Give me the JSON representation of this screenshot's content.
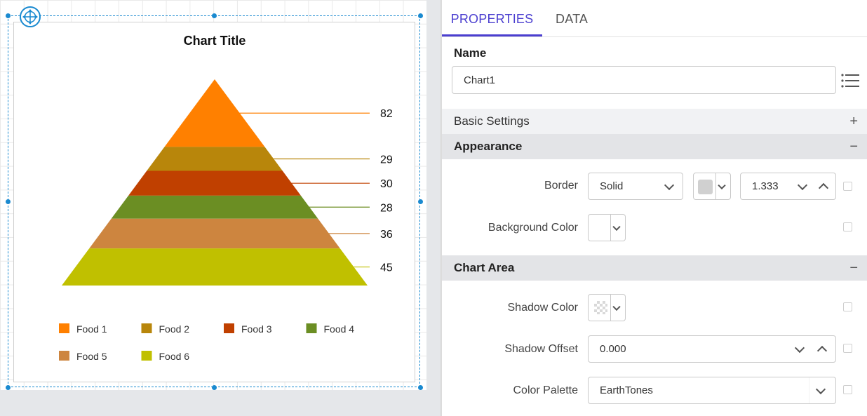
{
  "chart_data": {
    "type": "pyramid",
    "title": "Chart Title",
    "categories": [
      "Food 1",
      "Food 2",
      "Food 3",
      "Food 4",
      "Food 5",
      "Food 6"
    ],
    "values": [
      82,
      29,
      30,
      28,
      36,
      45
    ],
    "colors": [
      "#ff8000",
      "#b8860b",
      "#c04000",
      "#6b8e23",
      "#cd853f",
      "#c0c000"
    ],
    "legend_position": "bottom"
  },
  "panel": {
    "tabs": [
      {
        "label": "PROPERTIES",
        "active": true
      },
      {
        "label": "DATA",
        "active": false
      }
    ],
    "name_label": "Name",
    "name_value": "Chart1",
    "sections": {
      "basic": "Basic Settings",
      "appearance": "Appearance",
      "chart_area": "Chart Area"
    },
    "border_label": "Border",
    "border_style": "Solid",
    "border_color": "#d0d0d0",
    "border_width": "1.333",
    "background_label": "Background Color",
    "shadow_color_label": "Shadow Color",
    "shadow_offset_label": "Shadow Offset",
    "shadow_offset_value": "0.000",
    "palette_label": "Color Palette",
    "palette_value": "EarthTones"
  }
}
